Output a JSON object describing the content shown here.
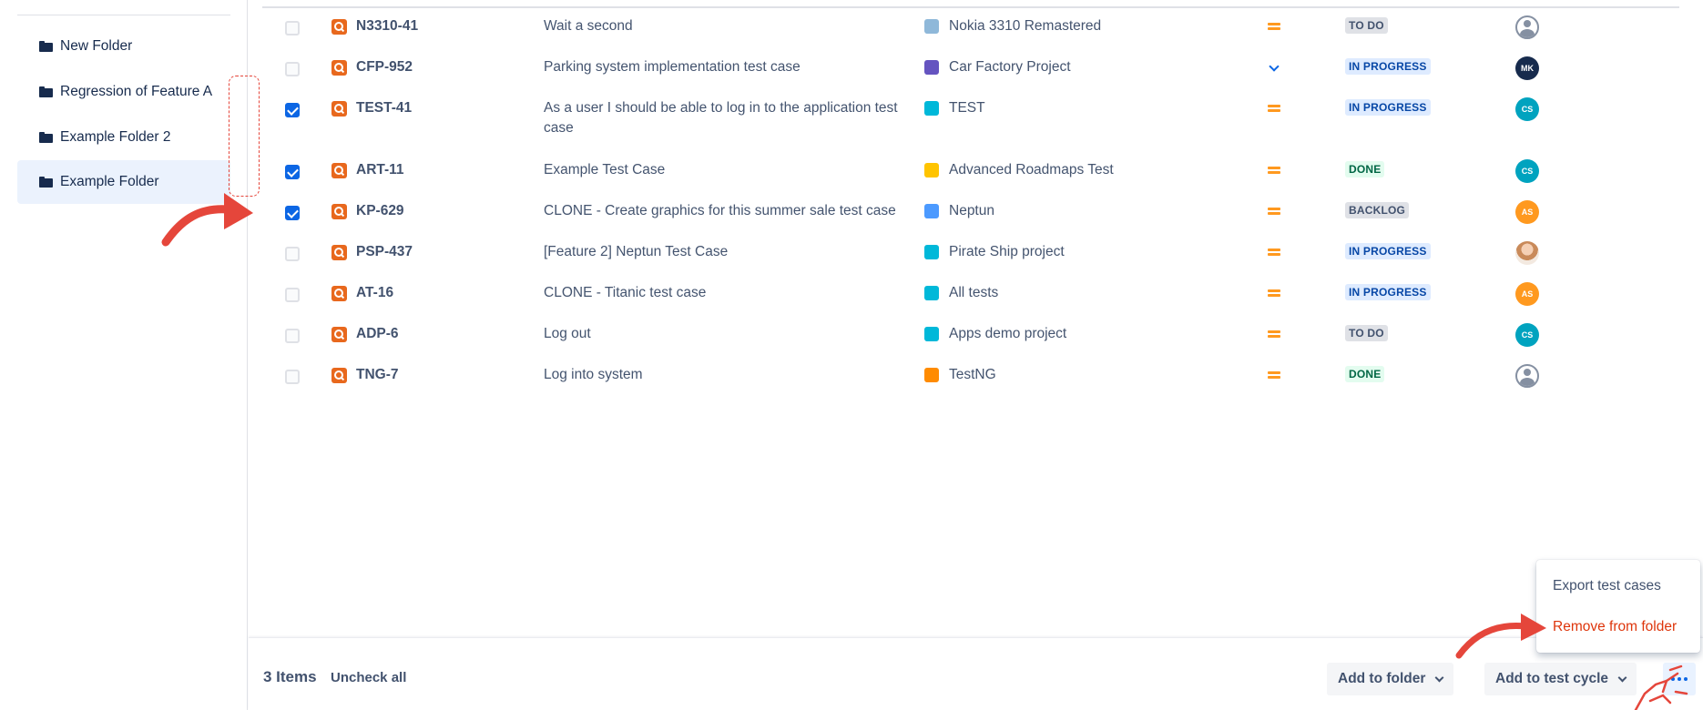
{
  "sidebar": {
    "folders": [
      {
        "label": "New Folder",
        "selected": false
      },
      {
        "label": "Regression of Feature A",
        "selected": false
      },
      {
        "label": "Example Folder 2",
        "selected": false
      },
      {
        "label": "Example Folder",
        "selected": true
      }
    ]
  },
  "table": {
    "rows": [
      {
        "checked": false,
        "key": "N3310-41",
        "summary": "Wait a second",
        "project": "Nokia 3310 Remastered",
        "project_color": "#8fb8d9",
        "priority": "medium",
        "status": "TO DO",
        "status_kind": "todo",
        "assignee": "",
        "assignee_kind": "default",
        "assignee_color": ""
      },
      {
        "checked": false,
        "key": "CFP-952",
        "summary": "Parking system implementation test case",
        "project": "Car Factory Project",
        "project_color": "#6554c0",
        "priority": "low",
        "status": "IN PROGRESS",
        "status_kind": "progress",
        "assignee": "MK",
        "assignee_kind": "initials",
        "assignee_color": "#172b4d"
      },
      {
        "checked": true,
        "key": "TEST-41",
        "summary": "As a user I should be able to log in to the application test case",
        "project": "TEST",
        "project_color": "#00b8d9",
        "priority": "medium",
        "status": "IN PROGRESS",
        "status_kind": "progress",
        "assignee": "CS",
        "assignee_kind": "initials",
        "assignee_color": "#00a3bf"
      },
      {
        "checked": true,
        "key": "ART-11",
        "summary": "Example Test Case",
        "project": "Advanced Roadmaps Test",
        "project_color": "#ffc400",
        "priority": "medium",
        "status": "DONE",
        "status_kind": "done",
        "assignee": "CS",
        "assignee_kind": "initials",
        "assignee_color": "#00a3bf"
      },
      {
        "checked": true,
        "key": "KP-629",
        "summary": "CLONE - Create graphics for this summer sale test case",
        "project": "Neptun",
        "project_color": "#4c9aff",
        "priority": "medium",
        "status": "BACKLOG",
        "status_kind": "backlog",
        "assignee": "AS",
        "assignee_kind": "initials",
        "assignee_color": "#ff991f"
      },
      {
        "checked": false,
        "key": "PSP-437",
        "summary": "[Feature 2] Neptun Test Case",
        "project": "Pirate Ship project",
        "project_color": "#00b8d9",
        "priority": "medium",
        "status": "IN PROGRESS",
        "status_kind": "progress",
        "assignee": "",
        "assignee_kind": "photo",
        "assignee_color": ""
      },
      {
        "checked": false,
        "key": "AT-16",
        "summary": "CLONE - Titanic test case",
        "project": "All tests",
        "project_color": "#00b8d9",
        "priority": "medium",
        "status": "IN PROGRESS",
        "status_kind": "progress",
        "assignee": "AS",
        "assignee_kind": "initials",
        "assignee_color": "#ff991f"
      },
      {
        "checked": false,
        "key": "ADP-6",
        "summary": "Log out",
        "project": "Apps demo project",
        "project_color": "#00b8d9",
        "priority": "medium",
        "status": "TO DO",
        "status_kind": "todo",
        "assignee": "CS",
        "assignee_kind": "initials",
        "assignee_color": "#00a3bf"
      },
      {
        "checked": false,
        "key": "TNG-7",
        "summary": "Log into system",
        "project": "TestNG",
        "project_color": "#ff8b00",
        "priority": "medium",
        "status": "DONE",
        "status_kind": "done",
        "assignee": "",
        "assignee_kind": "default",
        "assignee_color": ""
      }
    ]
  },
  "bottom_bar": {
    "items_count": "3 Items",
    "uncheck_all": "Uncheck all",
    "add_to_folder": "Add to folder",
    "add_to_test_cycle": "Add to test cycle"
  },
  "dropdown": {
    "export": "Export test cases",
    "remove": "Remove from folder"
  },
  "colors": {
    "accent": "#0c66e4",
    "annotation": "#e5463b"
  }
}
